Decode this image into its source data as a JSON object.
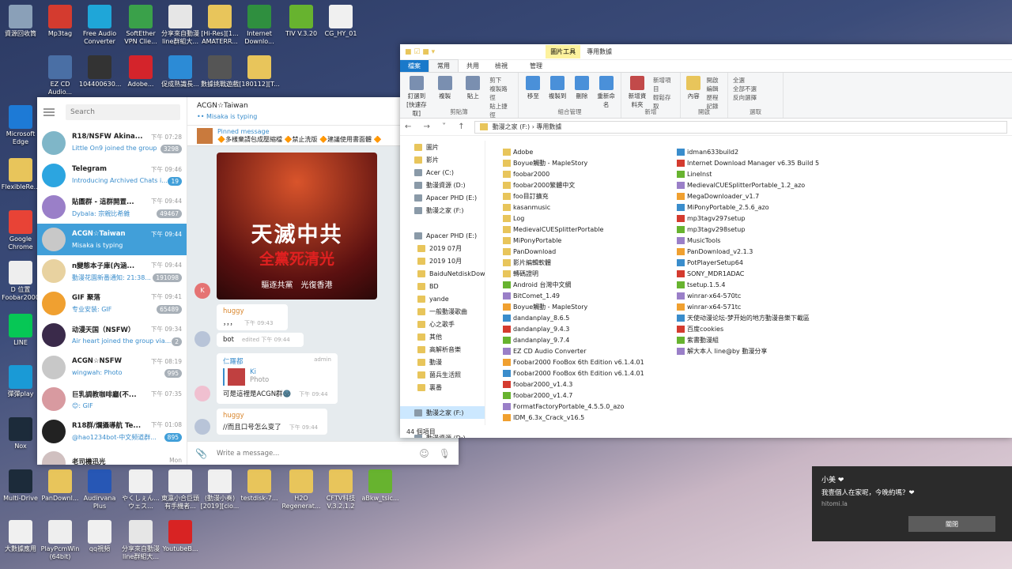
{
  "desktop_icons": [
    {
      "label": "資源回收筒",
      "color": "#8aa0b8"
    },
    {
      "label": "Mp3tag",
      "color": "#d43b2f"
    },
    {
      "label": "Free Audio Converter",
      "color": "#1fa6d8"
    },
    {
      "label": "SoftEther VPN Clie...",
      "color": "#3aa14a"
    },
    {
      "label": "分享來自動漫 line群組大...",
      "color": "#e6e6e6"
    },
    {
      "label": "[Hi-Res][1... AMATERR...",
      "color": "#e8c55b"
    },
    {
      "label": "Internet Downlo...",
      "color": "#2f8f3f"
    },
    {
      "label": "TIV V.3.20",
      "color": "#67b32f"
    },
    {
      "label": "CG_HY_01",
      "color": "#f0f0f0"
    },
    {
      "label": "Microsoft Edge",
      "color": "#1d7ad6"
    },
    {
      "label": "FlexibleRe...",
      "color": "#e8c55b"
    },
    {
      "label": "Google Chrome",
      "color": "#e84336"
    },
    {
      "label": "D 位置 Foobar2000",
      "color": "#eeeeee"
    },
    {
      "label": "LINE",
      "color": "#06c755"
    },
    {
      "label": "彈彈play",
      "color": "#1a9ad6"
    },
    {
      "label": "Nox",
      "color": "#1c2b3a"
    },
    {
      "label": "Multi-Drive",
      "color": "#1c2b3a"
    },
    {
      "label": "PanDownl...",
      "color": "#e8c55b"
    },
    {
      "label": "Audirvana Plus",
      "color": "#2757b5"
    },
    {
      "label": "やくしぇん... ウェス...",
      "color": "#f0f0f0"
    },
    {
      "label": "東瀛小合巨頭 有手機者...",
      "color": "#f0f0f0"
    },
    {
      "label": "(動漫小奏) [2019][cio...",
      "color": "#f0f0f0"
    },
    {
      "label": "testdisk-7...",
      "color": "#e8c55b"
    },
    {
      "label": "H2O Regenerat...",
      "color": "#e8c55b"
    },
    {
      "label": "CFTV科技 V.3.2.1.2",
      "color": "#e8c55b"
    },
    {
      "label": "aBkw_tsic...",
      "color": "#67b32f"
    },
    {
      "label": "大數據應用",
      "color": "#f0f0f0"
    },
    {
      "label": "PlayPcmWin (64bit)",
      "color": "#eeeeee"
    },
    {
      "label": "qq視頻",
      "color": "#f0f0f0"
    },
    {
      "label": "分享來自動漫 line群組大...",
      "color": "#e6e6e6"
    },
    {
      "label": "YoutubeB...",
      "color": "#d82323"
    },
    {
      "label": "EZ CD Audio...",
      "color": "#4a6fa5"
    },
    {
      "label": "104400630...",
      "color": "#333333"
    },
    {
      "label": "Adobe...",
      "color": "#d4242b"
    },
    {
      "label": "促成熟識長...",
      "color": "#2c8bd6"
    },
    {
      "label": "數據挑戰遊戲",
      "color": "#555555"
    },
    {
      "label": "[180112][T...",
      "color": "#e8c55b"
    }
  ],
  "telegram": {
    "search_placeholder": "Search",
    "chats": [
      {
        "name": "R18/NSFW Akina...",
        "time": "下午 07:28",
        "last": "Little On9 joined the group",
        "badge": "3298",
        "color": "#7fb6c8"
      },
      {
        "name": "Telegram",
        "time": "下午 09:46",
        "last": "Introducing Archived Chats i...",
        "badge": "19",
        "color": "#2ca5e0"
      },
      {
        "name": "貼圖群 - 這群開置...",
        "time": "下午 09:44",
        "last": "Dybala: 宗親比希雜",
        "badge": "49467",
        "color": "#9a7fc8"
      },
      {
        "name": "ACGN☆Taiwan",
        "time": "下午 09:44",
        "last": "Misaka is typing",
        "badge": "",
        "color": "#c8c8c8"
      },
      {
        "name": "n變態本子庫(內涵...",
        "time": "下午 09:44",
        "last": "動漫花園新番通知: 21:38...",
        "badge": "191098",
        "color": "#e8d2a0"
      },
      {
        "name": "GIF 聚落",
        "time": "下午 09:41",
        "last": "专业安装: GIF",
        "badge": "65489",
        "color": "#f0a030"
      },
      {
        "name": "动漫天国（NSFW）",
        "time": "下午 09:34",
        "last": "Air heart joined the group via...",
        "badge": "2",
        "color": "#3a2a4a"
      },
      {
        "name": "ACGN☆NSFW",
        "time": "下午 08:19",
        "last": "wingwah: Photo",
        "badge": "995",
        "color": "#c8c8c8"
      },
      {
        "name": "巨乳調教咖啡廳(不...",
        "time": "下午 07:35",
        "last": "😊: GIF",
        "badge": "",
        "color": "#d89aa0"
      },
      {
        "name": "R18群/爛攝導航 Te...",
        "time": "下午 01:08",
        "last": "@hao1234bot-中文频道群...",
        "badge": "895",
        "color": "#222222"
      },
      {
        "name": "老司機迅光",
        "time": "Mon",
        "last": "",
        "badge": "",
        "color": "#d0c0c0"
      }
    ],
    "header_title": "ACGN☆Taiwan",
    "header_status": "Misaka is typing",
    "pinned_label": "Pinned message",
    "pinned_text": "🔶多樣棄請包成壓縮檔 🔶禁止洗版 🔶建議使用書面體 🔶",
    "poster_big": "天滅中共",
    "poster_red": "全黨死清光",
    "poster_small": "驅逐共黨　光復香港",
    "avatar_k": "K",
    "messages": [
      {
        "sender": "huggy",
        "text": "，，，",
        "time": "下午 09:43"
      },
      {
        "sender": "",
        "text": "bot",
        "time": "edited 下午 09:44"
      },
      {
        "sender": "仁羅都",
        "admin": "admin",
        "reply_name": "Ki",
        "reply_text": "Photo",
        "text": "可是這裡是ACGN群🌚",
        "time": "下午 09:44"
      },
      {
        "sender": "huggy",
        "text": "//而且口号怎么变了",
        "time": "下午 09:44"
      }
    ],
    "input_placeholder": "Write a message..."
  },
  "explorer": {
    "contextual_tab": "圖片工具",
    "window_title": "專用數據",
    "tabs": [
      "檔案",
      "常用",
      "共用",
      "檢視",
      "管理"
    ],
    "ribbon_groups": [
      {
        "name": "剪貼簿",
        "buttons": [
          "釘選到[快速存取]",
          "複製",
          "貼上"
        ],
        "small": [
          "剪下",
          "複製路徑",
          "貼上捷徑"
        ]
      },
      {
        "name": "組合管理",
        "buttons": [
          "移至",
          "複製到",
          "刪除",
          "重新命名"
        ],
        "small": []
      },
      {
        "name": "新增",
        "buttons": [
          "新增資料夾"
        ],
        "small": [
          "新增項目",
          "輕鬆存取"
        ]
      },
      {
        "name": "開啟",
        "buttons": [
          "內容"
        ],
        "small": [
          "開啟",
          "編輯",
          "歷程記錄"
        ]
      },
      {
        "name": "選取",
        "buttons": [],
        "small": [
          "全選",
          "全部不選",
          "反向選擇"
        ]
      }
    ],
    "path": "動漫之家 (F:)  ›  專用數據",
    "nav": [
      {
        "label": "圖片",
        "sel": false
      },
      {
        "label": "影片",
        "sel": false
      },
      {
        "label": "Acer (C:)",
        "sel": false
      },
      {
        "label": "動漫資源 (D:)",
        "sel": false
      },
      {
        "label": "Apacer PHD (E:)",
        "sel": false
      },
      {
        "label": "動漫之家 (F:)",
        "sel": false
      },
      {
        "label": "",
        "sel": false
      },
      {
        "label": "Apacer PHD (E:)",
        "sel": false
      },
      {
        "label": "2019 07月",
        "sel": false
      },
      {
        "label": "2019 10月",
        "sel": false
      },
      {
        "label": "BaiduNetdiskDown",
        "sel": false
      },
      {
        "label": "BD",
        "sel": false
      },
      {
        "label": "yande",
        "sel": false
      },
      {
        "label": "一般動漫歌曲",
        "sel": false
      },
      {
        "label": "心之歌手",
        "sel": false
      },
      {
        "label": "其他",
        "sel": false
      },
      {
        "label": "高解析音樂",
        "sel": false
      },
      {
        "label": "動漫",
        "sel": false
      },
      {
        "label": "菌兵生活照",
        "sel": false
      },
      {
        "label": "裏番",
        "sel": false
      },
      {
        "label": "",
        "sel": false
      },
      {
        "label": "動漫之家 (F:)",
        "sel": true
      },
      {
        "label": "",
        "sel": false
      },
      {
        "label": "動漫資源 (D:)",
        "sel": false
      }
    ],
    "files_col1": [
      "Adobe",
      "Boyue觸動 - MapleStory",
      "foobar2000",
      "foobar2000繁體中文",
      "foo目訂擴充",
      "kasanmusic",
      "Log",
      "MedievalCUESplitterPortable",
      "MiPonyPortable",
      "PanDownload",
      "影片編輯軟體",
      "轉碼證明",
      "Android 台灣中文網",
      "BitComet_1.49",
      "Boyue觸動 - MapleStory",
      "dandanplay_8.6.5",
      "dandanplay_9.4.3",
      "dandanplay_9.7.4",
      "EZ CD Audio Converter",
      "Foobar2000 FooBox 6th Edition v6.1.4.01",
      "Foobar2000 FooBox 6th Edition v6.1.4.01",
      "foobar2000_v1.4.3",
      "foobar2000_v1.4.7",
      "FormatFactoryPortable_4.5.5.0_azo",
      "IDM_6.3x_Crack_v16.5"
    ],
    "files_col2": [
      "idman633build2",
      "Internet Download Manager v6.35 Build 5",
      "LineInst",
      "MedievalCUESplitterPortable_1.2_azo",
      "MegaDownloader_v1.7",
      "MiPonyPortable_2.5.6_azo",
      "mp3tagv297setup",
      "mp3tagv298setup",
      "MusicTools",
      "PanDownload_v2.1.3",
      "PotPlayerSetup64",
      "SONY_MDR1ADAC",
      "tsetup.1.5.4",
      "winrar-x64-570tc",
      "winrar-x64-571tc",
      "天使动漫论坛-梦开始的地方動漫音樂下載區",
      "百度cookies",
      "紫書動漫組",
      "解大本人 line@by 動漫分享"
    ],
    "status": "44 個項目"
  },
  "toast": {
    "title": "小美 ❤",
    "body": "我壹個人在家呢，今晚約嗎？❤",
    "source": "hitomi.la",
    "button": "關閉"
  }
}
